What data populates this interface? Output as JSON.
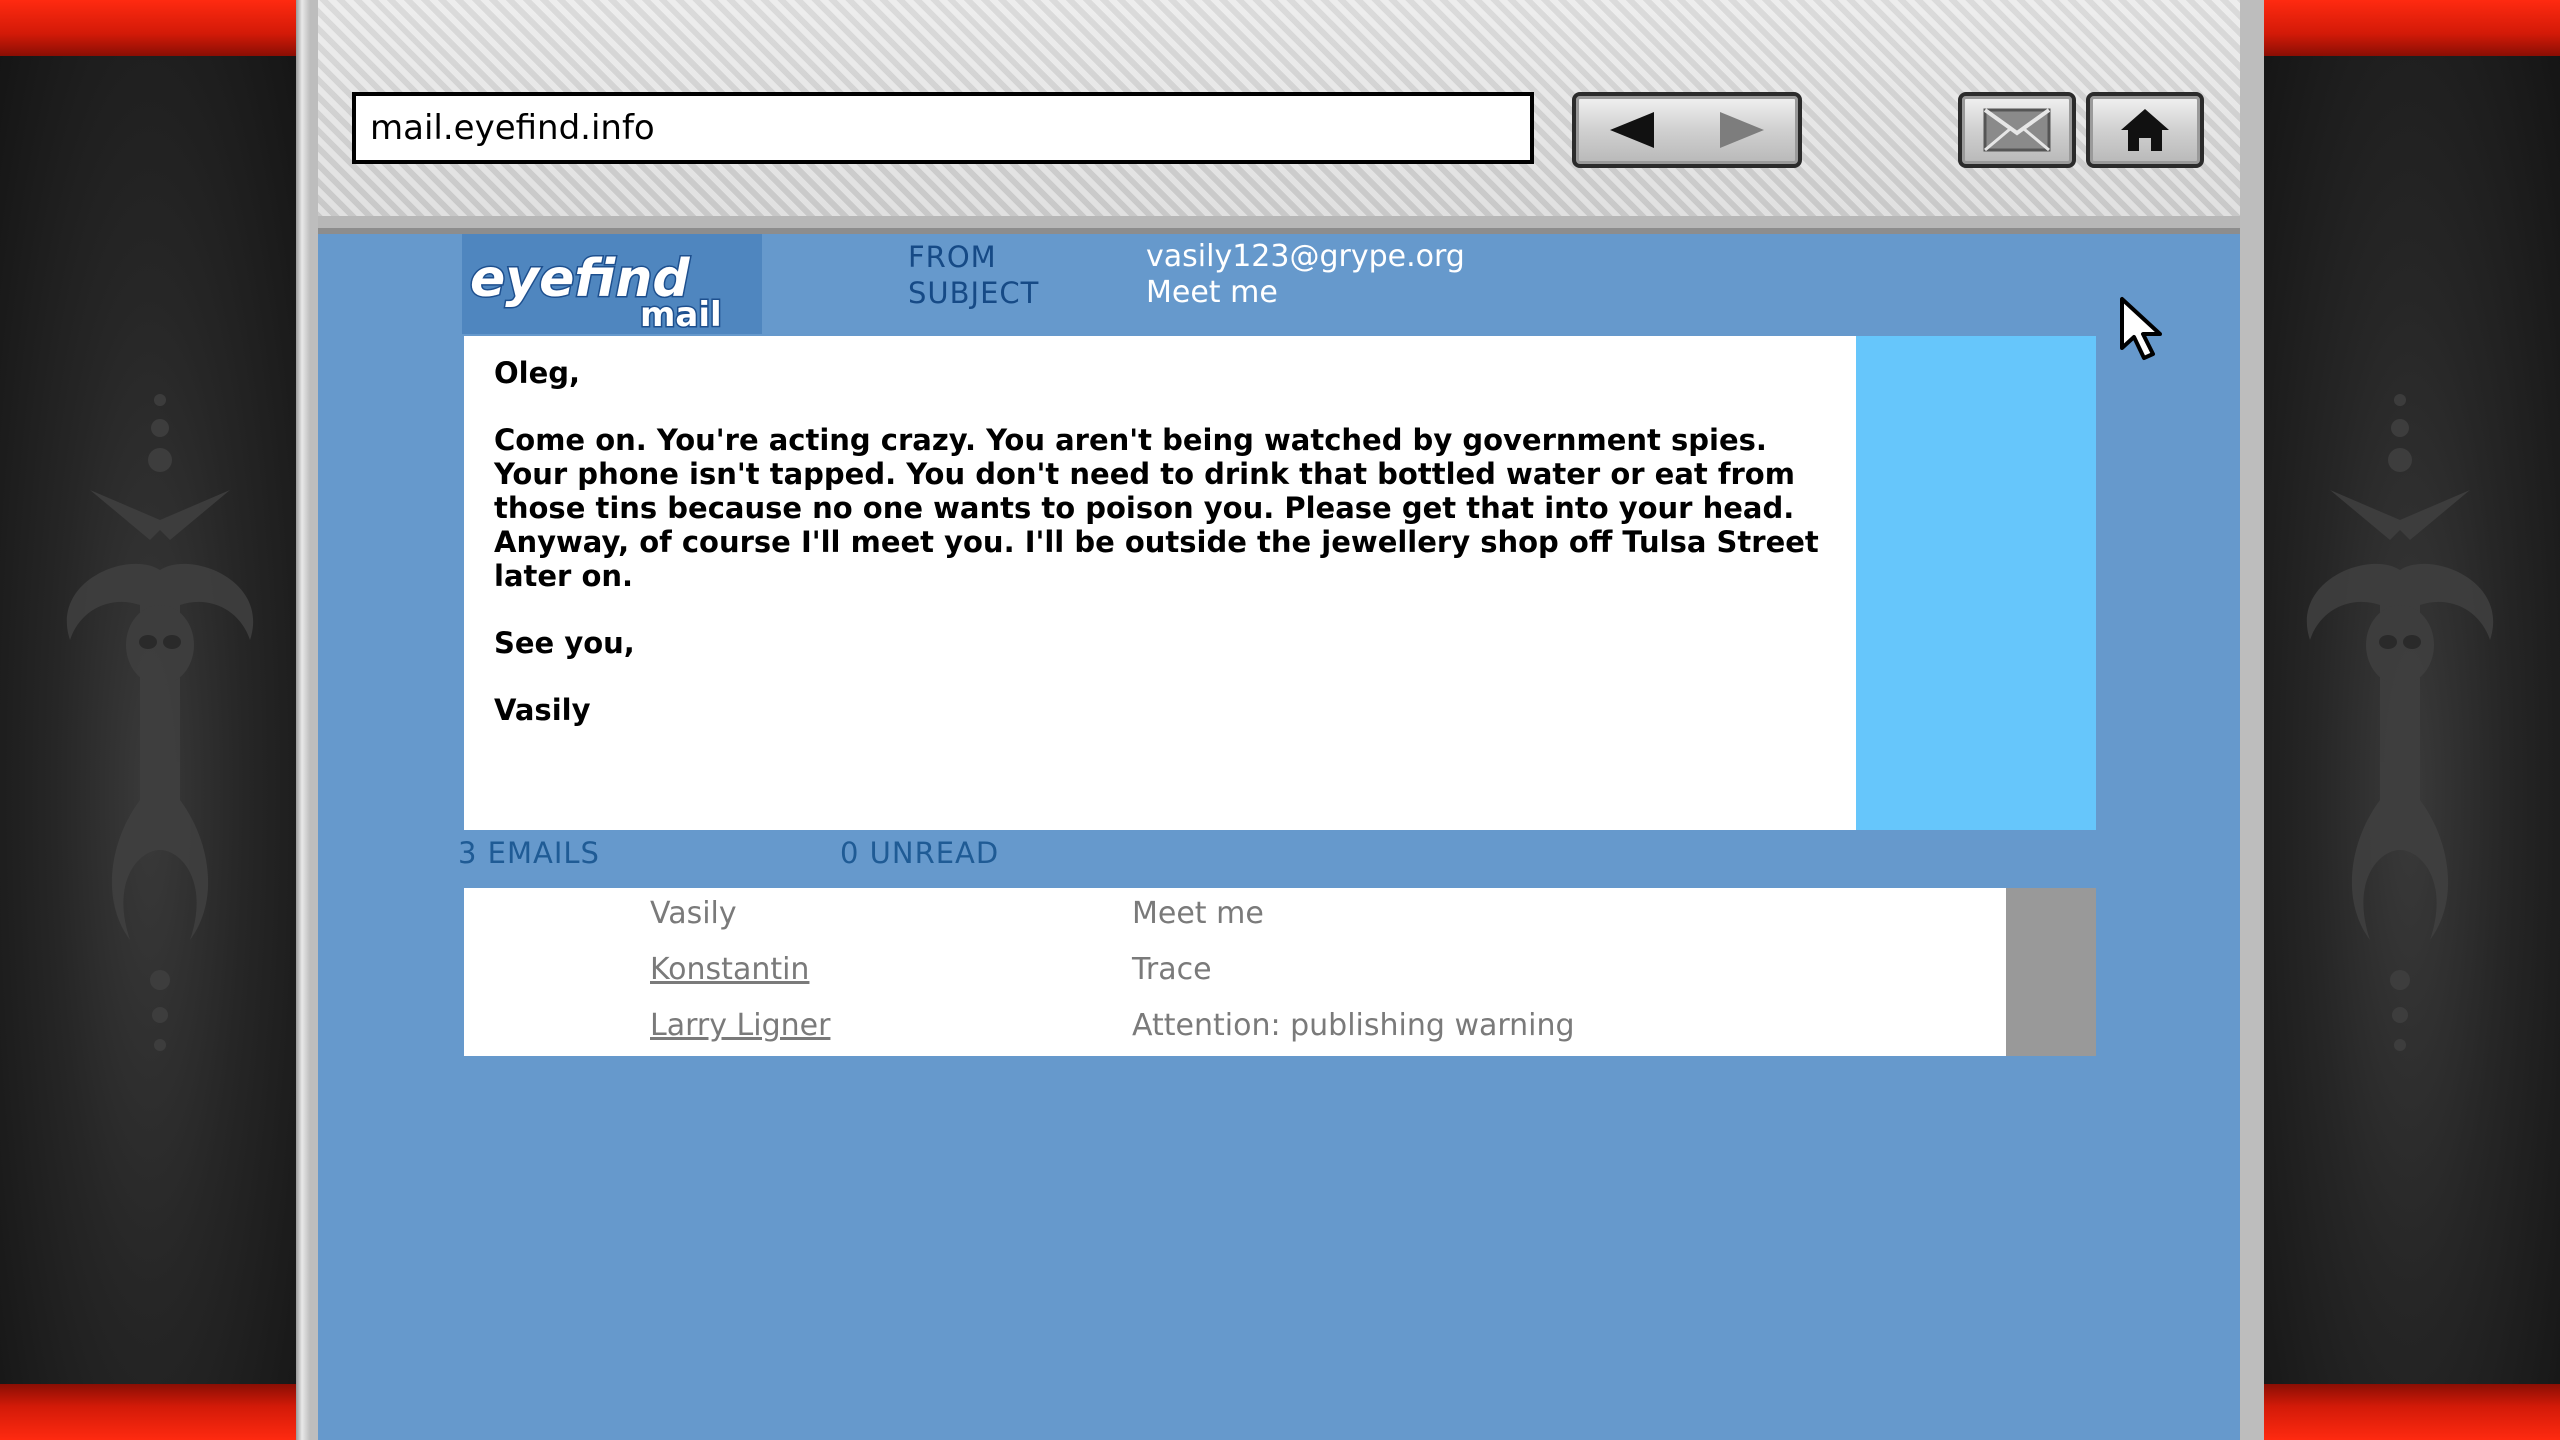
{
  "browser": {
    "url": "mail.eyefind.info",
    "buttons": {
      "back": "back-arrow-icon",
      "forward": "forward-arrow-icon",
      "mail": "envelope-icon",
      "home": "home-icon"
    }
  },
  "logo": {
    "word1": "eyefind",
    "word2": "mail",
    "colors": {
      "eye": "#ffffff",
      "find": "#f7b91c",
      "mail": "#1d4f8e"
    }
  },
  "header": {
    "from_label": "FROM",
    "from_value": "vasily123@grype.org",
    "subject_label": "SUBJECT",
    "subject_value": "Meet me"
  },
  "email": {
    "greeting": "Oleg,",
    "body": "Come on. You're acting crazy. You aren't being watched by government spies. Your phone isn't tapped. You don't need to drink that bottled water or eat from those tins because no one wants to poison you. Please get that into your head. Anyway, of course I'll meet you. I'll be outside the jewellery shop off Tulsa Street later on.",
    "signoff": "See you,",
    "signature": "Vasily"
  },
  "inbox": {
    "count_label": "3 EMAILS",
    "unread_label": "0 UNREAD",
    "emails": [
      {
        "sender": "Vasily",
        "subject": "Meet me",
        "selected": true
      },
      {
        "sender": "Konstantin",
        "subject": "Trace",
        "selected": false
      },
      {
        "sender": "Larry Ligner",
        "subject": "Attention: publishing warning",
        "selected": false
      }
    ]
  },
  "colors": {
    "page_bg": "#6699cc",
    "header_label": "#164a86",
    "side_panel": "#66c6fb",
    "accent_red": "#d31a08"
  }
}
